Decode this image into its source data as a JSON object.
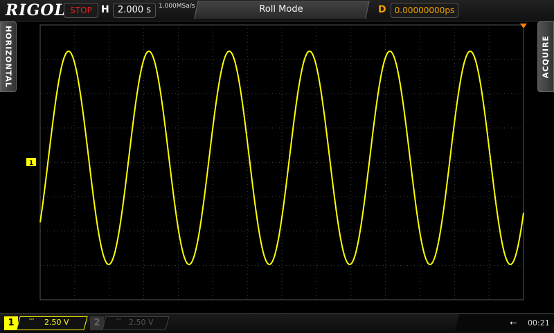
{
  "header": {
    "logo": "RIGOL",
    "run_status": "STOP",
    "horizontal_label": "H",
    "timebase": "2.000 s",
    "sample_rate": "1.000MSa/s",
    "mode": "Roll Mode",
    "delay_label": "D",
    "delay": "0.00000000ps"
  },
  "side_tabs": {
    "left": "HORIZONTAL",
    "right": "ACQUIRE"
  },
  "screen": {
    "channel1_marker": "1",
    "trace_color": "#ffff00",
    "trigger_marker_color": "#ff7f00"
  },
  "channels": [
    {
      "number": "1",
      "coupling_icon": "dc-coupling-icon",
      "scale": "2.50 V",
      "active": true
    },
    {
      "number": "2",
      "coupling_icon": "dc-coupling-icon",
      "scale": "2.50 V",
      "active": false
    }
  ],
  "status": {
    "usb_icon": "usb-icon",
    "time": "00:21"
  }
}
